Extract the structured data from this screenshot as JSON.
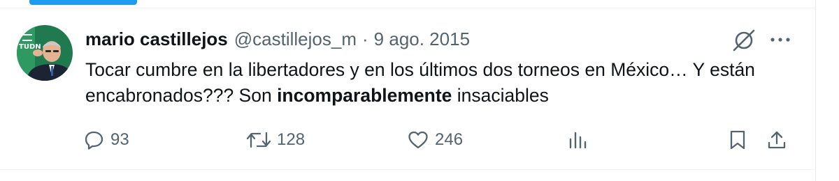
{
  "tweet": {
    "author_name": "mario castillejos",
    "author_handle": "@castillejos_m",
    "separator": "·",
    "date": "9 ago. 2015",
    "text_part1": "Tocar cumbre en la libertadores y en los últimos dos torneos en México… Y están encabronados??? Son ",
    "text_bold": "incomparablemente",
    "text_part2": " insaciables",
    "avatar_badge": "TUDN"
  },
  "actions": {
    "replies": "93",
    "retweets": "128",
    "likes": "246"
  },
  "icons": {
    "header": [
      "grok-icon",
      "more-icon"
    ],
    "actions": [
      "reply-icon",
      "retweet-icon",
      "like-icon",
      "views-icon",
      "bookmark-icon",
      "share-icon"
    ]
  },
  "colors": {
    "accent": "#1d9bf0",
    "secondary_text": "#536471",
    "primary_text": "#0f1419",
    "avatar_bg": "#1f7a4f"
  }
}
